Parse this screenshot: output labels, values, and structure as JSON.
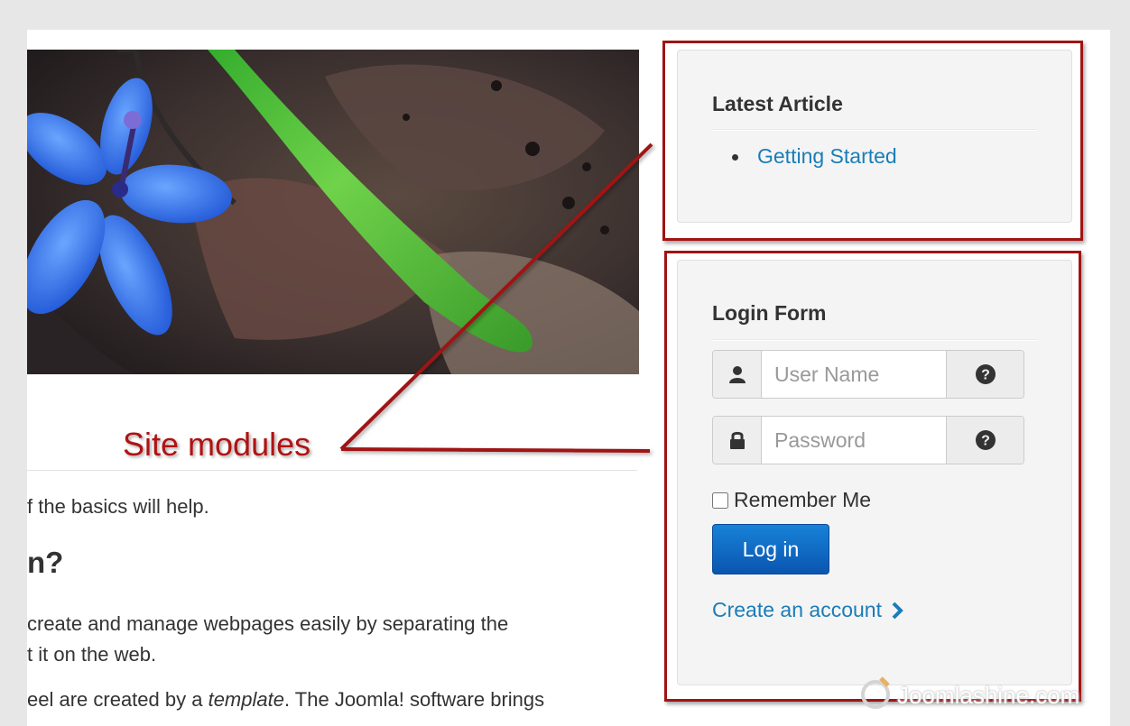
{
  "article": {
    "para1": "f the basics will help.",
    "heading2": "n?",
    "para2_line1": "create and manage webpages easily by separating the",
    "para2_line2": "t it on the web.",
    "para3_before": "eel are created by a ",
    "para3_em": "template",
    "para3_after": ". The Joomla! software brings"
  },
  "latest_module": {
    "title": "Latest Article",
    "items": [
      {
        "label": "Getting Started"
      }
    ]
  },
  "login_module": {
    "title": "Login Form",
    "username_placeholder": "User Name",
    "password_placeholder": "Password",
    "remember_label": "Remember Me",
    "remember_checked": false,
    "login_button": "Log in",
    "create_account": "Create an account"
  },
  "annotation": {
    "label": "Site modules",
    "color": "#a01414"
  },
  "watermark": {
    "text": "Joomlashine.com"
  },
  "icons": {
    "username_addon": "user-icon",
    "password_addon": "lock-icon",
    "help": "question-circle-icon",
    "create_chevron": "chevron-right-icon"
  },
  "colors": {
    "link": "#1a7db7",
    "button": "#0d62bf"
  }
}
